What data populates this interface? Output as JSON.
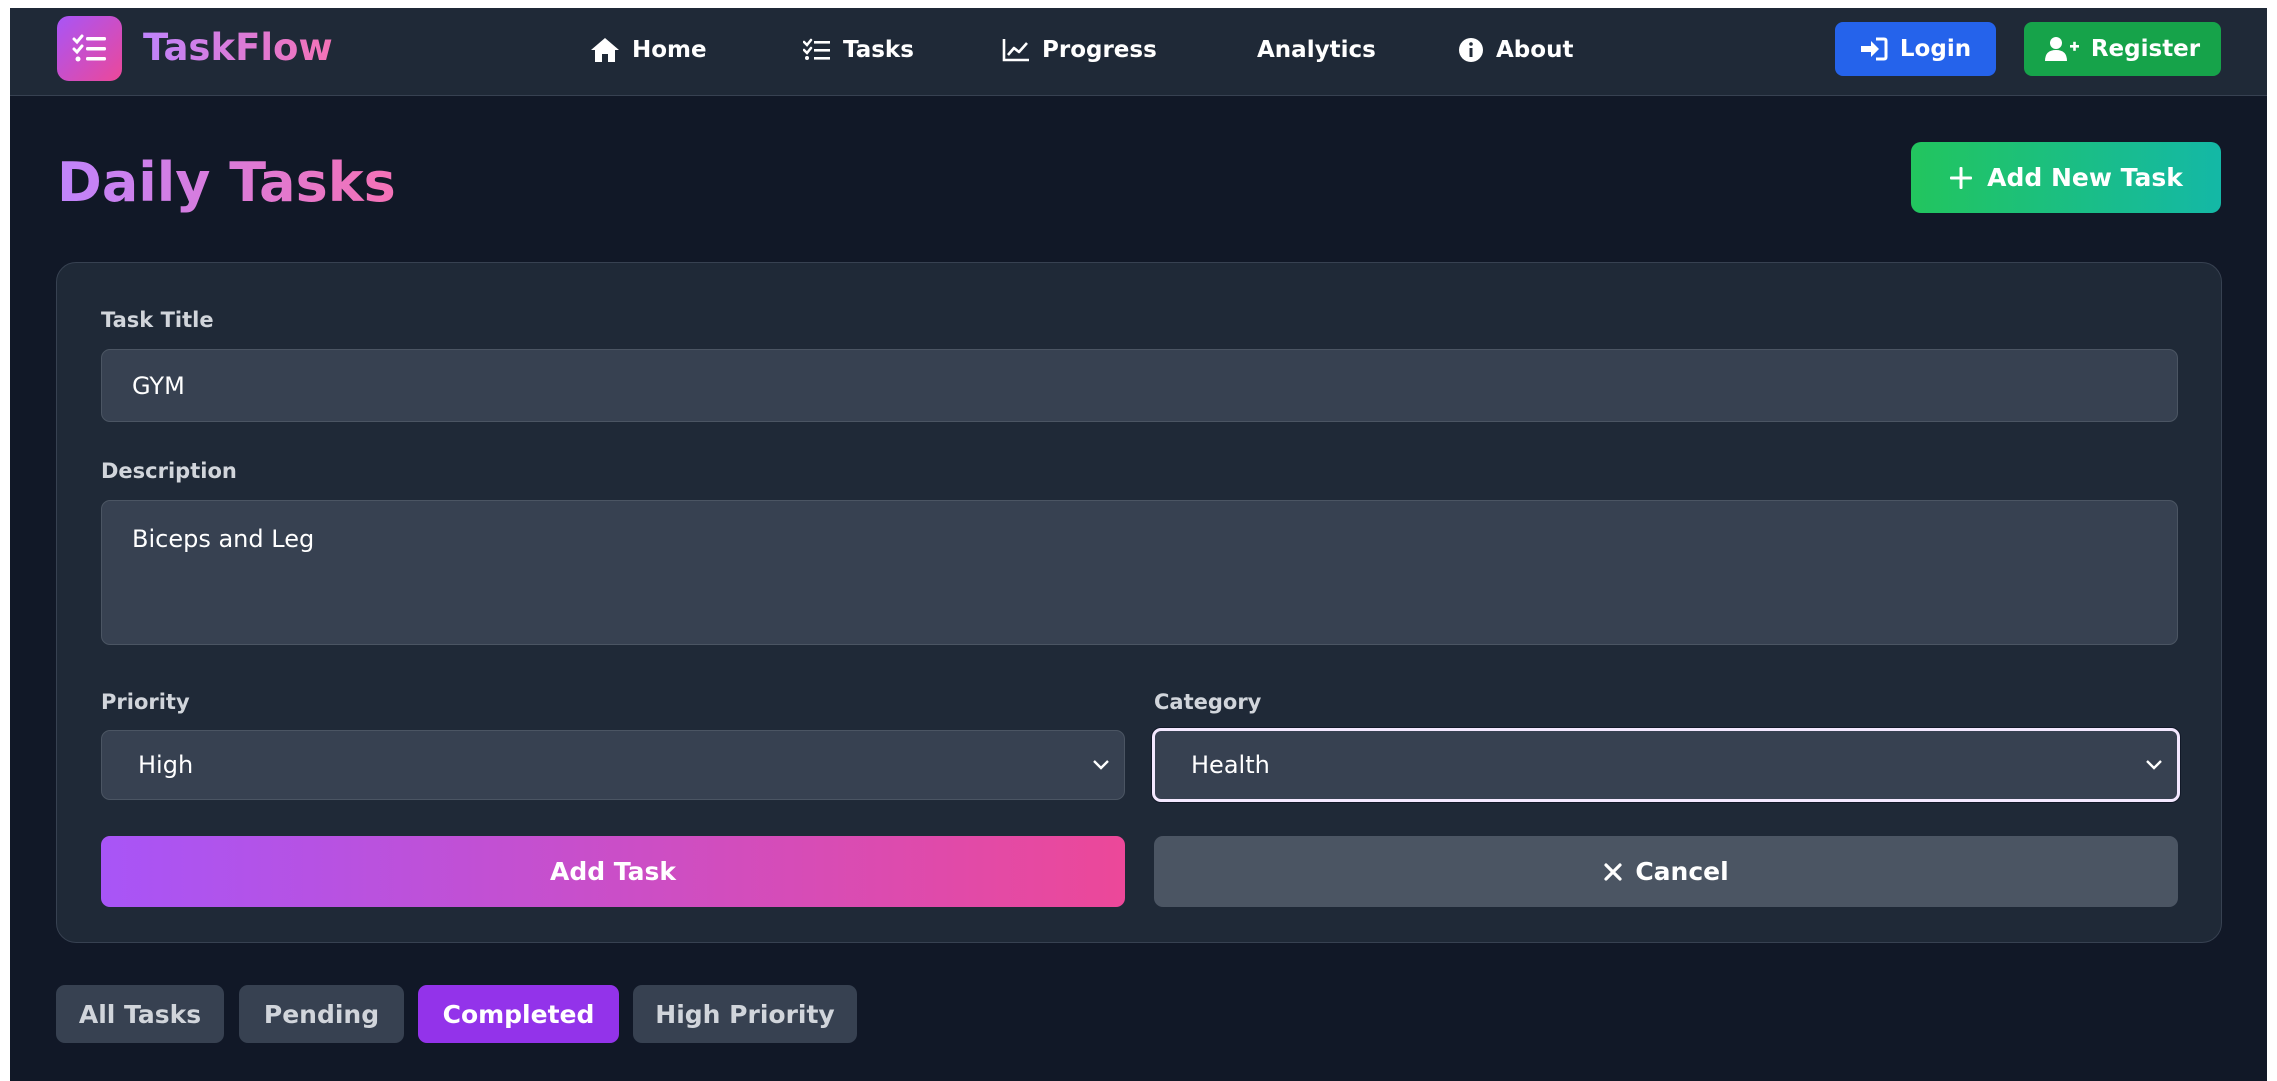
{
  "nav": {
    "brand": "TaskFlow",
    "links": [
      {
        "label": "Home",
        "icon": "home-icon"
      },
      {
        "label": "Tasks",
        "icon": "task-list-icon"
      },
      {
        "label": "Progress",
        "icon": "chart-line-icon"
      },
      {
        "label": "Analytics",
        "icon": ""
      },
      {
        "label": "About",
        "icon": "info-circle-icon"
      }
    ],
    "login_label": "Login",
    "register_label": "Register"
  },
  "header": {
    "title": "Daily Tasks",
    "add_new_label": "Add New Task"
  },
  "form": {
    "title_label": "Task Title",
    "title_value": "GYM",
    "description_label": "Description",
    "description_value": "Biceps and Leg",
    "priority_label": "Priority",
    "priority_value": "High",
    "category_label": "Category",
    "category_value": "Health",
    "submit_label": "Add Task",
    "cancel_label": "Cancel"
  },
  "filters": [
    {
      "label": "All Tasks",
      "active": false
    },
    {
      "label": "Pending",
      "active": false
    },
    {
      "label": "Completed",
      "active": true
    },
    {
      "label": "High Priority",
      "active": false
    }
  ],
  "colors": {
    "background": "#111827",
    "surface": "#1f2937",
    "field": "#374151",
    "accent_purple": "#a855f7",
    "accent_pink": "#ec4899",
    "login_blue": "#2563eb",
    "register_green": "#16a34a",
    "filter_active": "#9333ea"
  }
}
